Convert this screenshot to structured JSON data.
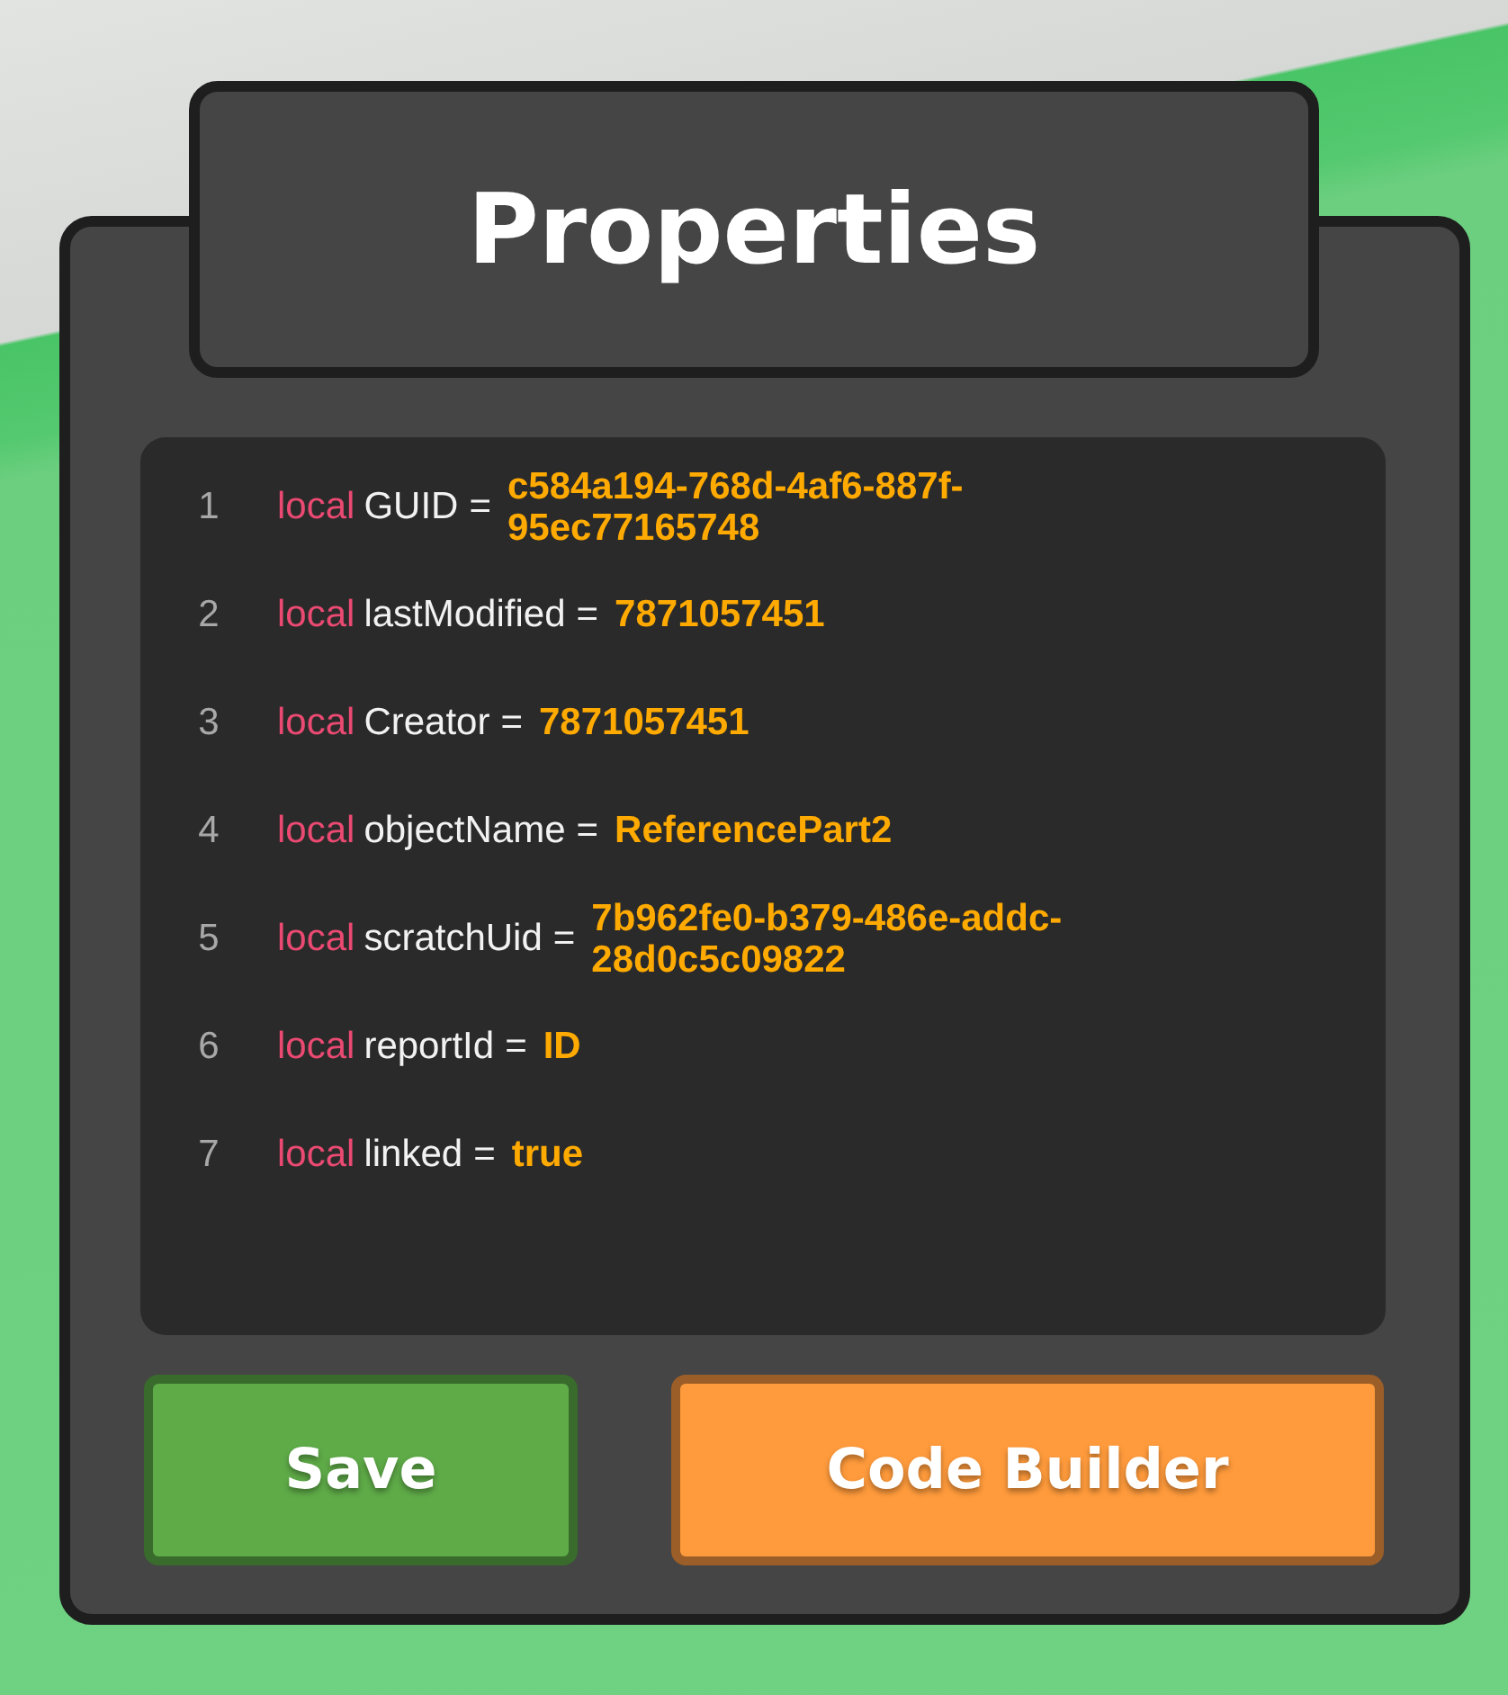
{
  "title": "Properties",
  "code_lines": [
    {
      "number": "1",
      "keyword": "local",
      "name": "GUID",
      "operator": "=",
      "value": "c584a194-768d-4af6-887f-95ec77165748"
    },
    {
      "number": "2",
      "keyword": "local",
      "name": "lastModified",
      "operator": "=",
      "value": "7871057451"
    },
    {
      "number": "3",
      "keyword": "local",
      "name": "Creator",
      "operator": "=",
      "value": "7871057451"
    },
    {
      "number": "4",
      "keyword": "local",
      "name": "objectName",
      "operator": "=",
      "value": "ReferencePart2"
    },
    {
      "number": "5",
      "keyword": "local",
      "name": "scratchUid",
      "operator": "=",
      "value": "7b962fe0-b379-486e-addc-28d0c5c09822"
    },
    {
      "number": "6",
      "keyword": "local",
      "name": "reportId",
      "operator": "=",
      "value": "ID"
    },
    {
      "number": "7",
      "keyword": "local",
      "name": "linked",
      "operator": "=",
      "value": "true"
    }
  ],
  "buttons": [
    {
      "label": "Save",
      "kind": "save"
    },
    {
      "label": "Code Builder",
      "kind": "builder"
    }
  ]
}
